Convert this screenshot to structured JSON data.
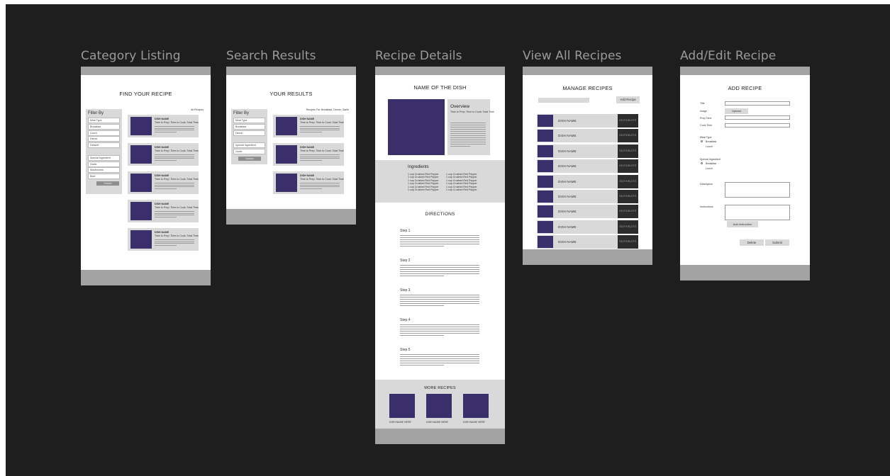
{
  "frames": {
    "category": {
      "label": "Category Listing",
      "title": "FIND YOUR RECIPE",
      "count": "## Recipes",
      "filter_title": "Filter By",
      "filters": [
        "Meal Type",
        "Breakfast",
        "Lunch",
        "Dinner",
        "Dessert",
        "",
        "Special Ingredient",
        "Garlic",
        "Mushrooms",
        "Beef"
      ],
      "search_button": "Search",
      "card_title": "DISH NAME",
      "card_subtitle": "Time to Prep: Time to Cook: Total Time"
    },
    "search": {
      "label": "Search Results",
      "title": "YOUR RESULTS",
      "summary": "Recipes For: Breakfast, Dinner, Garlic",
      "filter_title": "Filter By",
      "filters": [
        "Meal Type",
        "Breakfast",
        "Dinner",
        "",
        "Special Ingredient",
        "Garlic"
      ],
      "search_button": "Search",
      "card_title": "DISH NAME",
      "card_subtitle": "Time to Prep: Time to Cook: Total Time"
    },
    "details": {
      "label": "Recipe Details",
      "title": "NAME OF THE DISH",
      "overview_title": "Overview",
      "overview_sub": "Time to Prep: Time to Cook: Total Time",
      "ingredients_title": "Ingredients",
      "ingredients_left": [
        "1 cup Crushed Red Pepper",
        "1 cup Crushed Red Pepper",
        "1 cup Crushed Red Pepper",
        "1 cup Crushed Red Pepper",
        "1 cup Crushed Red Pepper",
        "1 cup Crushed Red Pepper"
      ],
      "ingredients_right": [
        "1 cup Crushed Red Pepper",
        "1 cup Crushed Red Pepper",
        "1 cup Crushed Red Pepper",
        "1 cup Crushed Red Pepper",
        "1 cup Crushed Red Pepper",
        "1 cup Crushed Red Pepper"
      ],
      "directions_title": "DIRECTIONS",
      "steps": [
        "Step 1",
        "Step 2",
        "Step 3",
        "Step 4",
        "Step 5"
      ],
      "more_title": "MORE RECIPES",
      "more_items": [
        "DISH NAME HERE",
        "DISH NAME HERE",
        "DISH NAME HERE"
      ]
    },
    "manage": {
      "label": "View All Recipes",
      "title": "MANAGE RECIPES",
      "add_button": "Add Recipe",
      "row_name": "DISH NAME",
      "row_button": "EDIT/DELETE",
      "row_count": 9
    },
    "add": {
      "label": "Add/Edit Recipe",
      "title": "ADD RECIPE",
      "title_label": "Title",
      "image_label": "Image",
      "upload_button": "Upload",
      "prep_label": "Prep Time",
      "cook_label": "Cook Time",
      "meal_label": "Meal Type",
      "meal_options": [
        "Breakfast",
        "Lunch"
      ],
      "special_label": "Special Ingredient",
      "special_options": [
        "Breakfast",
        "Lunch"
      ],
      "desc_label": "Description",
      "instr_label": "Instructions",
      "add_instruction_button": "Add Instruction",
      "delete_button": "Delete",
      "submit_button": "Submit"
    }
  }
}
